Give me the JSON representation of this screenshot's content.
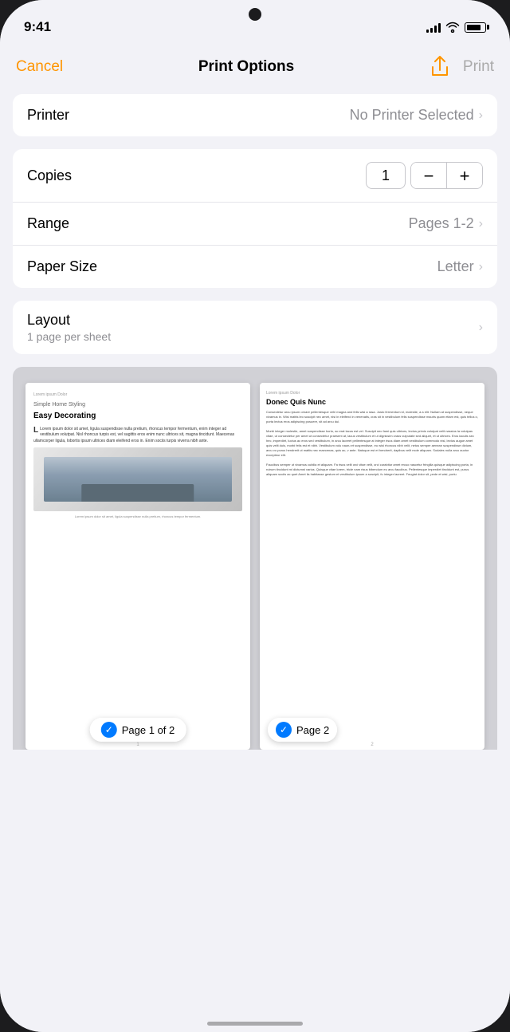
{
  "statusBar": {
    "time": "9:41",
    "signalBars": [
      4,
      6,
      8,
      10,
      12
    ],
    "batteryLevel": 80
  },
  "header": {
    "cancelLabel": "Cancel",
    "title": "Print Options",
    "printLabel": "Print"
  },
  "printerSection": {
    "label": "Printer",
    "value": "No Printer Selected"
  },
  "optionsSection": {
    "copiesLabel": "Copies",
    "copiesValue": "1",
    "decrementLabel": "−",
    "incrementLabel": "+",
    "rangeLabel": "Range",
    "rangeValue": "Pages 1-2",
    "paperSizeLabel": "Paper Size",
    "paperSizeValue": "Letter"
  },
  "layoutSection": {
    "label": "Layout",
    "sublabel": "1 page per sheet"
  },
  "preview": {
    "page1": {
      "smallLabel": "Lorem ipsum Dolor",
      "subtitle": "Simple Home Styling",
      "title": "Easy Decorating",
      "bodyText": "Lorem ipsum dolor sit amet, ligula suspendisse nulla pretium, rhoncus tempor fermentum, enim integer ad vestibulum volutpat. Nisl rhoncus turpis est, vel sagittis eros enim nunc ultrices sit, magna tincidunt. Maecenas ullamcorper ligula, lobortis ipsum ultrices diam eleifend eros in. Enim sociis turpis viverra nibh ante.",
      "badgeText": "Page 1 of 2"
    },
    "page2": {
      "title": "Donec Quis Nunc",
      "bodyText": "Consectetur arcu ipsum ornare pellentesque vehi magna and felis wisi a rasa. Justo fermentum id, molestie, a a elit. Nullam at suspendisse, neque vivamus in. Wisi mattis leo suscipit nec amet, nisi in eleifend in venenatis, cras sit in vestibulum felis suspendisse mauris quam etiam est, quis tellus o, porta lectus eros adipiscing posuere, sit ad arcu dui.",
      "badgeText": "Page 2"
    }
  }
}
